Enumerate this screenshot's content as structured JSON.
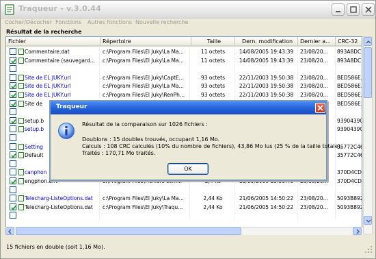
{
  "window": {
    "title": "Traqueur - v.3.0.44"
  },
  "menu": [
    "Cocher/Décocher",
    "Fonctions",
    "Autres fonctions",
    "Nouvelle recherche"
  ],
  "results_label": "Résultat de la recherche",
  "columns": [
    "Fichier",
    "Répertoire",
    "Taille",
    "Dern. modification",
    "Dernier a...",
    "CRC-32"
  ],
  "rows": [
    {
      "checked": false,
      "name": "Commentaire.dat",
      "blue": false,
      "dir": "c:\\Program Files\\El Juky\\La Ma...",
      "size": "11 octets",
      "modified": "14/08/2005 19:43:39",
      "last": "23/08/20...",
      "crc": "893A8DC..."
    },
    {
      "checked": true,
      "name": "Commentaire (sauvegard...",
      "blue": false,
      "dir": "c:\\Program Files\\El Juky\\La Ma...",
      "size": "11 octets",
      "modified": "14/08/2005 19:43:39",
      "last": "23/08/20...",
      "crc": "893A8DC..."
    },
    {
      "checked": false,
      "name": "",
      "blue": false,
      "dir": "",
      "size": "",
      "modified": "",
      "last": "",
      "crc": ""
    },
    {
      "checked": false,
      "name": "Site de EL JUKY.url",
      "blue": true,
      "dir": "c:\\Program Files\\El Juky\\CaptE...",
      "size": "93 octets",
      "modified": "22/11/2003 19:50:38",
      "last": "23/08/20...",
      "crc": "BED586E..."
    },
    {
      "checked": true,
      "name": "Site de EL JUKY.url",
      "blue": true,
      "dir": "c:\\Program Files\\El Juky\\La Ma...",
      "size": "93 octets",
      "modified": "22/11/2003 19:50:38",
      "last": "23/08/20...",
      "crc": "BED586E..."
    },
    {
      "checked": true,
      "name": "Site de EL JUKY.url",
      "blue": true,
      "dir": "c:\\Program Files\\El Juky\\RenPh...",
      "size": "93 octets",
      "modified": "22/11/2003 19:50:38",
      "last": "23/08/20...",
      "crc": "BED586E..."
    },
    {
      "checked": true,
      "name": "Site de",
      "blue": false,
      "dir": "",
      "size": "",
      "modified": "",
      "last": "23/08/20...",
      "crc": "BED586E..."
    },
    {
      "checked": false,
      "name": "",
      "blue": false,
      "dir": "",
      "size": "",
      "modified": "",
      "last": "",
      "crc": ""
    },
    {
      "checked": true,
      "name": "setup.b",
      "blue": false,
      "dir": "",
      "size": "",
      "modified": "",
      "last": "23/08/20...",
      "crc": "9390439C..."
    },
    {
      "checked": false,
      "name": "setup.b",
      "blue": true,
      "dir": "",
      "size": "",
      "modified": "",
      "last": "23/08/20...",
      "crc": "9390439C..."
    },
    {
      "checked": false,
      "name": "",
      "blue": false,
      "dir": "",
      "size": "",
      "modified": "",
      "last": "",
      "crc": ""
    },
    {
      "checked": false,
      "name": "Setting",
      "blue": true,
      "dir": "",
      "size": "",
      "modified": "",
      "last": "",
      "crc": "35772C46..."
    },
    {
      "checked": true,
      "name": "Default",
      "blue": false,
      "dir": "",
      "size": "",
      "modified": "",
      "last": "",
      "crc": "35772C46..."
    },
    {
      "checked": false,
      "name": "",
      "blue": false,
      "dir": "",
      "size": "",
      "modified": "",
      "last": "",
      "crc": ""
    },
    {
      "checked": false,
      "name": "canphon",
      "blue": true,
      "dir": "",
      "size": "",
      "modified": "",
      "last": "",
      "crc": "370D4CD..."
    },
    {
      "checked": true,
      "name": "engphon.env",
      "blue": false,
      "dir": "c:\\Program Files\\Fichiers com...",
      "size": "2,4 Ko",
      "modified": "15/09/2000 15:30:48",
      "last": "23/08/20...",
      "crc": "370D4CD..."
    },
    {
      "checked": false,
      "name": "",
      "blue": false,
      "dir": "",
      "size": "",
      "modified": "",
      "last": "",
      "crc": ""
    },
    {
      "checked": false,
      "name": "Telecharg-ListeOptions.dat",
      "blue": true,
      "dir": "c:\\Program Files\\El Juky\\La Ma...",
      "size": "2,44 Ko",
      "modified": "21/06/2005 14:50:22",
      "last": "23/08/20...",
      "crc": "5093B892..."
    },
    {
      "checked": true,
      "name": "Telecharg-ListeOptions.dat",
      "blue": false,
      "dir": "c:\\Program Files\\El Juky\\Traqu...",
      "size": "2,44 Ko",
      "modified": "21/06/2005 14:50:22",
      "last": "23/08/20...",
      "crc": "5093B892..."
    },
    {
      "checked": false,
      "name": "",
      "blue": false,
      "dir": "",
      "size": "",
      "modified": "",
      "last": "",
      "crc": ""
    }
  ],
  "status": "15 fichiers en double (soit 1,16 Mo).",
  "dialog": {
    "title": "Traqueur",
    "line1": "Résultat de la comparaison sur 1026 fichiers :",
    "line2": "Doublons : 15 doubles trouvés, occupant 1,16 Mo.",
    "line3": "Calculs : 108 CRC calculés (10% du nombre de fichiers), 43,86 Mo lus (25 % de la taille totale).",
    "line4": "Traités : 170,71 Mo traités.",
    "ok": "OK"
  },
  "colors": {
    "dialog_title": "#2460d8",
    "link_blue": "#0000cc",
    "checkmark": "#21a121"
  }
}
